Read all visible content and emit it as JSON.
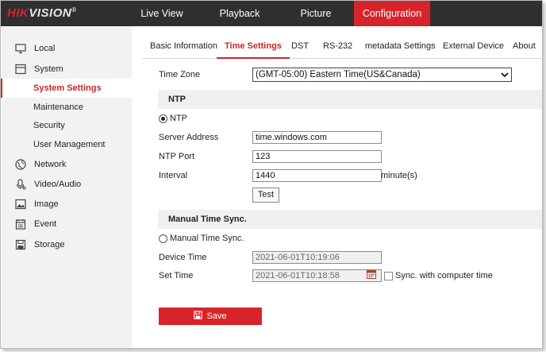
{
  "brand": {
    "logo_red": "HIK",
    "logo_white": "VISION",
    "logo_reg": "®"
  },
  "colors": {
    "accent": "#d7242a",
    "topbar": "#2f2f2f",
    "sidebar_bg": "#f2f2f2"
  },
  "nav": {
    "tabs": [
      {
        "label": "Live View",
        "active": false
      },
      {
        "label": "Playback",
        "active": false
      },
      {
        "label": "Picture",
        "active": false
      },
      {
        "label": "Configuration",
        "active": true
      }
    ]
  },
  "sidebar": {
    "items": [
      {
        "label": "Local",
        "icon": "monitor-icon"
      },
      {
        "label": "System",
        "icon": "system-icon"
      },
      {
        "label": "System Settings",
        "active": true
      },
      {
        "label": "Maintenance"
      },
      {
        "label": "Security"
      },
      {
        "label": "User Management"
      },
      {
        "label": "Network",
        "icon": "globe-icon"
      },
      {
        "label": "Video/Audio",
        "icon": "mic-icon"
      },
      {
        "label": "Image",
        "icon": "image-icon"
      },
      {
        "label": "Event",
        "icon": "event-icon"
      },
      {
        "label": "Storage",
        "icon": "storage-icon"
      }
    ]
  },
  "subtabs": [
    {
      "label": "Basic Information"
    },
    {
      "label": "Time Settings",
      "active": true
    },
    {
      "label": "DST"
    },
    {
      "label": "RS-232"
    },
    {
      "label": "metadata Settings"
    },
    {
      "label": "External Device"
    },
    {
      "label": "About"
    }
  ],
  "form": {
    "time_zone_label": "Time Zone",
    "time_zone_value": "(GMT-05:00) Eastern Time(US&Canada)",
    "ntp_section": "NTP",
    "ntp_radio_label": "NTP",
    "server_address_label": "Server Address",
    "server_address_value": "time.windows.com",
    "ntp_port_label": "NTP Port",
    "ntp_port_value": "123",
    "interval_label": "Interval",
    "interval_value": "1440",
    "interval_unit": "minute(s)",
    "test_button": "Test",
    "manual_section": "Manual Time Sync.",
    "manual_radio_label": "Manual Time Sync.",
    "device_time_label": "Device Time",
    "device_time_value": "2021-06-01T10:19:06",
    "set_time_label": "Set Time",
    "set_time_value": "2021-06-01T10:18:58",
    "sync_label": "Sync. with computer time",
    "save_button": "Save"
  }
}
